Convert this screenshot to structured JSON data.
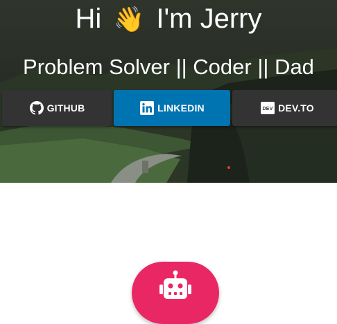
{
  "hero": {
    "greeting": "Hi",
    "wave": "👋",
    "name": "I'm Jerry",
    "subtitle": "Problem Solver || Coder || Dad"
  },
  "social": [
    {
      "label": "GITHUB",
      "icon": "github-icon",
      "color": "#333333"
    },
    {
      "label": "LINKEDIN",
      "icon": "linkedin-icon",
      "color": "#0073b1"
    },
    {
      "label": "DEV.TO",
      "icon": "devto-icon",
      "color": "#333333"
    }
  ],
  "devto_icon_text": "DEV",
  "chatbot": {
    "icon": "robot-icon",
    "color": "#ea2765"
  }
}
